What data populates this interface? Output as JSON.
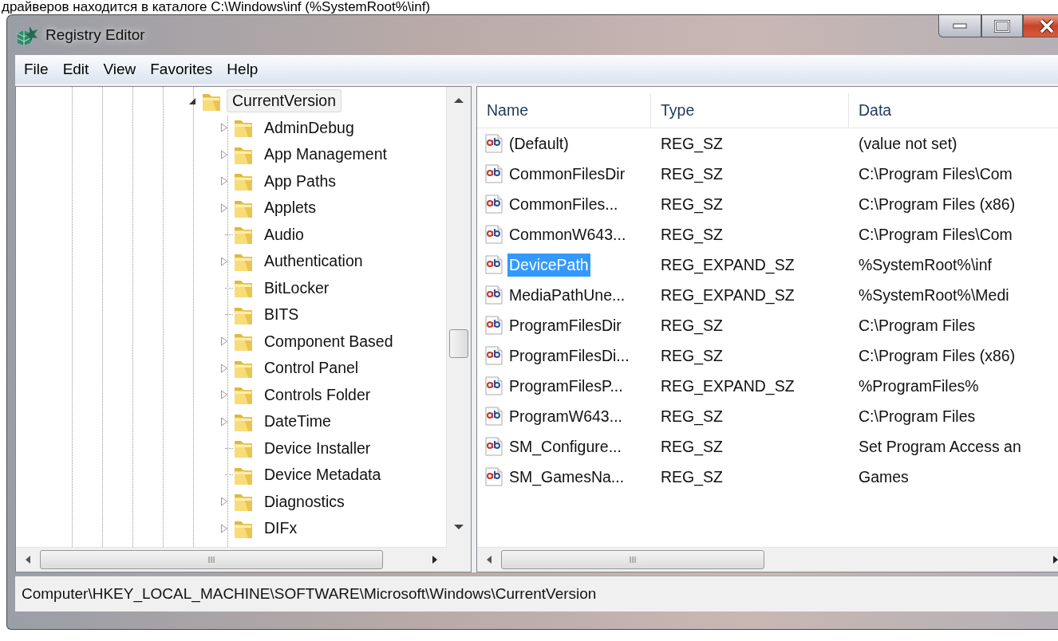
{
  "caption": "драйверов находится в каталоге C:\\Windows\\inf (%SystemRoot%\\inf)",
  "window": {
    "title": "Registry Editor"
  },
  "menu": [
    {
      "label": "File"
    },
    {
      "label": "Edit"
    },
    {
      "label": "View"
    },
    {
      "label": "Favorites"
    },
    {
      "label": "Help"
    }
  ],
  "tree": {
    "items": [
      {
        "label": "CurrentVersion",
        "kind": "branch",
        "expanded": true,
        "selected": true,
        "children": [
          {
            "label": "AdminDebug",
            "kind": "branch",
            "expanded": false,
            "selected": false
          },
          {
            "label": "App Management",
            "kind": "branch",
            "expanded": false,
            "selected": false
          },
          {
            "label": "App Paths",
            "kind": "branch",
            "expanded": false,
            "selected": false
          },
          {
            "label": "Applets",
            "kind": "branch",
            "expanded": false,
            "selected": false
          },
          {
            "label": "Audio",
            "kind": "leaf",
            "selected": false
          },
          {
            "label": "Authentication",
            "kind": "branch",
            "expanded": false,
            "selected": false
          },
          {
            "label": "BitLocker",
            "kind": "leaf",
            "selected": false
          },
          {
            "label": "BITS",
            "kind": "leaf",
            "selected": false
          },
          {
            "label": "Component Based",
            "kind": "branch",
            "expanded": false,
            "selected": false
          },
          {
            "label": "Control Panel",
            "kind": "branch",
            "expanded": false,
            "selected": false
          },
          {
            "label": "Controls Folder",
            "kind": "branch",
            "expanded": false,
            "selected": false
          },
          {
            "label": "DateTime",
            "kind": "branch",
            "expanded": false,
            "selected": false
          },
          {
            "label": "Device Installer",
            "kind": "leaf",
            "selected": false
          },
          {
            "label": "Device Metadata",
            "kind": "leaf",
            "selected": false
          },
          {
            "label": "Diagnostics",
            "kind": "branch",
            "expanded": false,
            "selected": false
          },
          {
            "label": "DIFx",
            "kind": "branch",
            "expanded": false,
            "selected": false
          }
        ]
      }
    ]
  },
  "list": {
    "columns": [
      "Name",
      "Type",
      "Data"
    ],
    "rows": [
      {
        "name": "(Default)",
        "type": "REG_SZ",
        "data": "(value not set)",
        "selected": false
      },
      {
        "name": "CommonFilesDir",
        "type": "REG_SZ",
        "data": "C:\\Program Files\\Com",
        "selected": false
      },
      {
        "name": "CommonFiles...",
        "type": "REG_SZ",
        "data": "C:\\Program Files (x86)",
        "selected": false
      },
      {
        "name": "CommonW643...",
        "type": "REG_SZ",
        "data": "C:\\Program Files\\Com",
        "selected": false
      },
      {
        "name": "DevicePath",
        "type": "REG_EXPAND_SZ",
        "data": "%SystemRoot%\\inf",
        "selected": true
      },
      {
        "name": "MediaPathUne...",
        "type": "REG_EXPAND_SZ",
        "data": "%SystemRoot%\\Medi",
        "selected": false
      },
      {
        "name": "ProgramFilesDir",
        "type": "REG_SZ",
        "data": "C:\\Program Files",
        "selected": false
      },
      {
        "name": "ProgramFilesDi...",
        "type": "REG_SZ",
        "data": "C:\\Program Files (x86)",
        "selected": false
      },
      {
        "name": "ProgramFilesP...",
        "type": "REG_EXPAND_SZ",
        "data": "%ProgramFiles%",
        "selected": false
      },
      {
        "name": "ProgramW643...",
        "type": "REG_SZ",
        "data": "C:\\Program Files",
        "selected": false
      },
      {
        "name": "SM_Configure...",
        "type": "REG_SZ",
        "data": "Set Program Access an",
        "selected": false
      },
      {
        "name": "SM_GamesNa...",
        "type": "REG_SZ",
        "data": "Games",
        "selected": false
      }
    ]
  },
  "status_bar": "Computer\\HKEY_LOCAL_MACHINE\\SOFTWARE\\Microsoft\\Windows\\CurrentVersion"
}
